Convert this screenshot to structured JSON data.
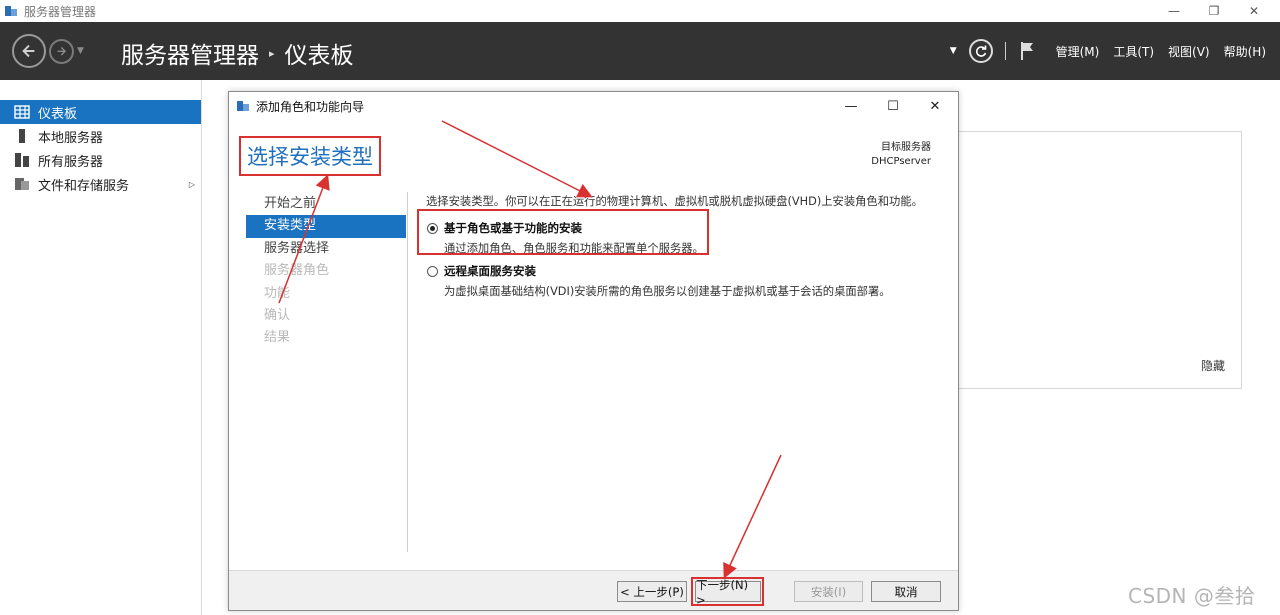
{
  "window": {
    "title": "服务器管理器",
    "controls": {
      "minimize": "—",
      "restore": "❐",
      "close": "✕"
    }
  },
  "header": {
    "breadcrumb_root": "服务器管理器",
    "breadcrumb_separator": "▸",
    "breadcrumb_page": "仪表板",
    "menus": [
      "管理(M)",
      "工具(T)",
      "视图(V)",
      "帮助(H)"
    ]
  },
  "sidebar": {
    "items": [
      {
        "label": "仪表板",
        "icon": "dashboard-icon",
        "active": true
      },
      {
        "label": "本地服务器",
        "icon": "server-icon",
        "active": false
      },
      {
        "label": "所有服务器",
        "icon": "servers-icon",
        "active": false
      },
      {
        "label": "文件和存储服务",
        "icon": "storage-icon",
        "active": false,
        "expand": "▷"
      }
    ]
  },
  "background": {
    "hide_link": "隐藏",
    "watermark": "CSDN @叁拾"
  },
  "dialog": {
    "title": "添加角色和功能向导",
    "controls": {
      "minimize": "—",
      "maximize": "☐",
      "close": "✕"
    },
    "heading": "选择安装类型",
    "target_label": "目标服务器",
    "target_server": "DHCPserver",
    "steps": [
      {
        "label": "开始之前",
        "state": "normal"
      },
      {
        "label": "安装类型",
        "state": "active"
      },
      {
        "label": "服务器选择",
        "state": "normal"
      },
      {
        "label": "服务器角色",
        "state": "disabled"
      },
      {
        "label": "功能",
        "state": "disabled"
      },
      {
        "label": "确认",
        "state": "disabled"
      },
      {
        "label": "结果",
        "state": "disabled"
      }
    ],
    "description": "选择安装类型。你可以在正在运行的物理计算机、虚拟机或脱机虚拟硬盘(VHD)上安装角色和功能。",
    "options": [
      {
        "title": "基于角色或基于功能的安装",
        "desc": "通过添加角色、角色服务和功能来配置单个服务器。",
        "checked": true
      },
      {
        "title": "远程桌面服务安装",
        "desc": "为虚拟桌面基础结构(VDI)安装所需的角色服务以创建基于虚拟机或基于会话的桌面部署。",
        "checked": false
      }
    ],
    "buttons": {
      "prev": "< 上一步(P)",
      "next": "下一步(N) >",
      "install": "安装(I)",
      "cancel": "取消"
    }
  },
  "colors": {
    "header_bg": "#333333",
    "accent_blue": "#1a73c1",
    "heading_blue": "#1f6fbf",
    "annotation_red": "#d93030"
  }
}
